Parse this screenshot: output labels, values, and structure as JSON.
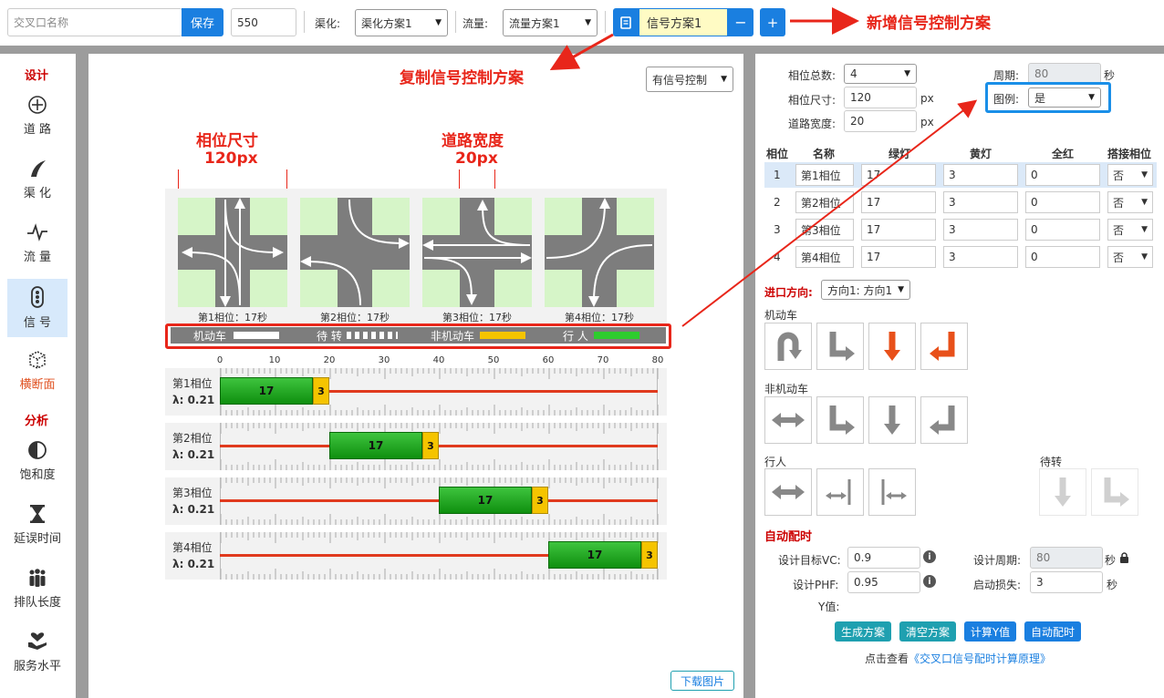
{
  "toolbar": {
    "name_placeholder": "交叉口名称",
    "save": "保存",
    "size_value": "550",
    "channel_label": "渠化:",
    "channel_value": "渠化方案1",
    "flow_label": "流量:",
    "flow_value": "流量方案1",
    "signal_value": "信号方案1",
    "minus": "−",
    "plus": "+"
  },
  "annotations": {
    "new_plan": "新增信号控制方案",
    "copy_plan": "复制信号控制方案",
    "phase_size": "相位尺寸",
    "phase_size_val": "120px",
    "road_width": "道路宽度",
    "road_width_val": "20px"
  },
  "sidebar": {
    "design_head": "设计",
    "analysis_head": "分析",
    "items": [
      {
        "label": "道 路",
        "icon": "compass-icon"
      },
      {
        "label": "渠 化",
        "icon": "road-curve-icon"
      },
      {
        "label": "流 量",
        "icon": "pulse-icon"
      },
      {
        "label": "信 号",
        "icon": "traffic-light-icon"
      },
      {
        "label": "横断面",
        "icon": "cube-icon"
      },
      {
        "label": "饱和度",
        "icon": "half-circle-icon"
      },
      {
        "label": "延误时间",
        "icon": "hourglass-icon"
      },
      {
        "label": "排队长度",
        "icon": "people-icon"
      },
      {
        "label": "服务水平",
        "icon": "hand-heart-icon"
      }
    ]
  },
  "canvas": {
    "control_select": "有信号控制",
    "phase_captions": [
      "第1相位：17秒",
      "第2相位：17秒",
      "第3相位：17秒",
      "第4相位：17秒"
    ],
    "legend": {
      "motor": "机动车",
      "wait": "待 转",
      "nonmotor": "非机动车",
      "ped": "行 人"
    },
    "ticks": [
      "0",
      "10",
      "20",
      "30",
      "40",
      "50",
      "60",
      "70",
      "80"
    ],
    "timelines": [
      {
        "name": "第1相位",
        "lambda": "λ:  0.21",
        "start": 0,
        "green": 17,
        "yellow": 3
      },
      {
        "name": "第2相位",
        "lambda": "λ:  0.21",
        "start": 20,
        "green": 17,
        "yellow": 3
      },
      {
        "name": "第3相位",
        "lambda": "λ:  0.21",
        "start": 40,
        "green": 17,
        "yellow": 3
      },
      {
        "name": "第4相位",
        "lambda": "λ:  0.21",
        "start": 60,
        "green": 17,
        "yellow": 3
      }
    ],
    "download": "下载图片"
  },
  "settings": {
    "phase_total_label": "相位总数:",
    "phase_total": "4",
    "period_label": "周期:",
    "period_value": "80",
    "period_unit": "秒",
    "phase_size_label": "相位尺寸:",
    "phase_size": "120",
    "px1": "px",
    "legend_label": "图例:",
    "legend_value": "是",
    "road_width_label": "道路宽度:",
    "road_width": "20",
    "px2": "px"
  },
  "phase_table": {
    "headers": [
      "相位",
      "名称",
      "绿灯",
      "黄灯",
      "全红",
      "搭接相位"
    ],
    "rows": [
      {
        "num": "1",
        "name": "第1相位",
        "green": "17",
        "yellow": "3",
        "red": "0",
        "overlap": "否"
      },
      {
        "num": "2",
        "name": "第2相位",
        "green": "17",
        "yellow": "3",
        "red": "0",
        "overlap": "否"
      },
      {
        "num": "3",
        "name": "第3相位",
        "green": "17",
        "yellow": "3",
        "red": "0",
        "overlap": "否"
      },
      {
        "num": "4",
        "name": "第4相位",
        "green": "17",
        "yellow": "3",
        "red": "0",
        "overlap": "否"
      }
    ]
  },
  "approach": {
    "label": "进口方向:",
    "value": "方向1: 方向1",
    "motor_title": "机动车",
    "nonmotor_title": "非机动车",
    "ped_title": "行人",
    "wait_title": "待转"
  },
  "auto": {
    "title": "自动配时",
    "vc_label": "设计目标VC:",
    "vc_value": "0.9",
    "period_label": "设计周期:",
    "period_value": "80",
    "period_unit": "秒",
    "phf_label": "设计PHF:",
    "phf_value": "0.95",
    "loss_label": "启动损失:",
    "loss_value": "3",
    "loss_unit": "秒",
    "y_label": "Y值:",
    "btn_gen": "生成方案",
    "btn_clear": "清空方案",
    "btn_y": "计算Y值",
    "btn_auto": "自动配时",
    "link_prefix": "点击查看",
    "link_text": "《交叉口信号配时计算原理》"
  },
  "colors": {
    "primary": "#1a7fe0",
    "teal": "#1fa0b0",
    "annotation_red": "#e8261a",
    "green_bar": "#1faa1f",
    "yellow_bar": "#f5c400"
  }
}
